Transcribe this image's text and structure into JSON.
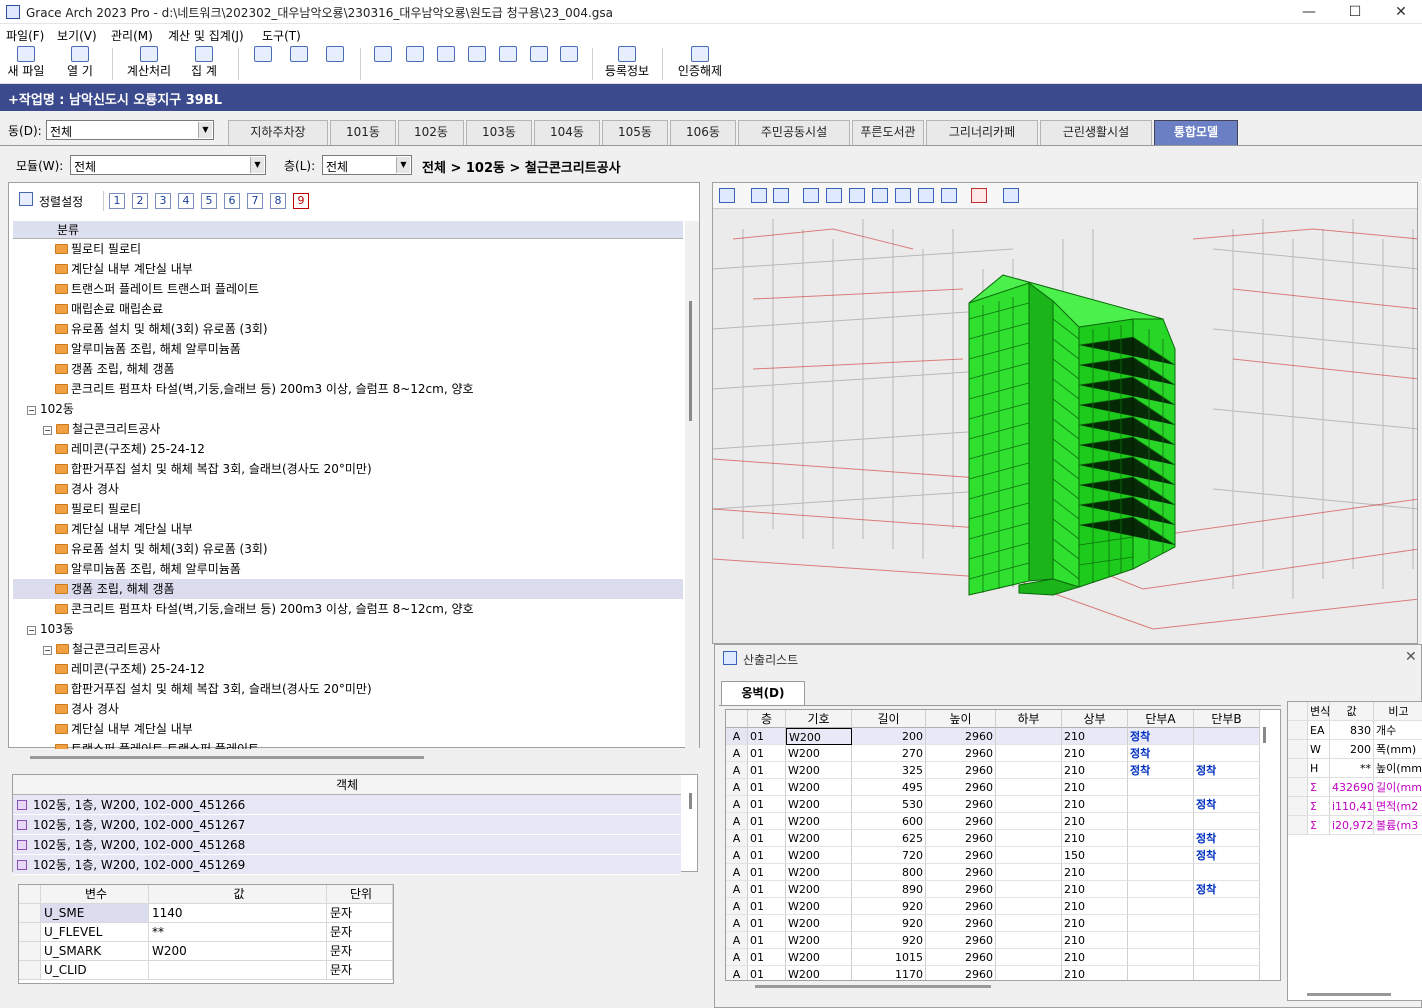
{
  "window": {
    "title": "Grace Arch 2023 Pro - d:\\네트워크\\202302_대우남악오룡\\230316_대우남악오룡\\원도급 청구용\\23_004.gsa",
    "minimize": "—",
    "maximize": "☐",
    "close": "✕"
  },
  "menu": [
    "파일(F)",
    "보기(V)",
    "관리(M)",
    "계산 및 집계(J)",
    "도구(T)"
  ],
  "toolbar": {
    "new": "새 파일",
    "open": "열 기",
    "calc": "계산처리",
    "sum": "집 계",
    "reg": "등록정보",
    "auth": "인증해제"
  },
  "job": "+작업명 : 남악신도시 오룡지구 39BL",
  "dong": {
    "label": "동(D):",
    "value": "전체"
  },
  "tabs": [
    "지하주차장",
    "101동",
    "102동",
    "103동",
    "104동",
    "105동",
    "106동",
    "주민공동시설",
    "푸른도서관",
    "그리너리카페",
    "근린생활시설",
    "통합모델"
  ],
  "module": {
    "label": "모듈(W):",
    "value": "전체"
  },
  "floor": {
    "label": "층(L):",
    "value": "전체"
  },
  "breadcrumb": "전체 > 102동 > 철근콘크리트공사",
  "sort": {
    "label": "정렬설정",
    "nums": [
      "1",
      "2",
      "3",
      "4",
      "5",
      "6",
      "7",
      "8",
      "9"
    ]
  },
  "tree": {
    "header": "분류",
    "rows": [
      {
        "level": 3,
        "text": "필로티  필로티"
      },
      {
        "level": 3,
        "text": "계단실 내부  계단실 내부"
      },
      {
        "level": 3,
        "text": "트랜스퍼 플레이트  트랜스퍼 플레이트"
      },
      {
        "level": 3,
        "text": "매립손료  매립손료"
      },
      {
        "level": 3,
        "text": "유로폼 설치 및 해체(3회)  유로폼 (3회)"
      },
      {
        "level": 3,
        "text": "알루미늄폼 조립, 해체  알루미늄폼"
      },
      {
        "level": 3,
        "text": "갱폼 조립, 해체  갱폼"
      },
      {
        "level": 3,
        "text": "콘크리트 펌프차 타설(벽,기둥,슬래브 등)  200m3 이상, 슬럼프 8~12cm, 양호"
      },
      {
        "level": 1,
        "text": "102동",
        "pm": "−"
      },
      {
        "level": 2,
        "text": "철근콘크리트공사",
        "pm": "−"
      },
      {
        "level": 3,
        "text": "레미콘(구조체)  25-24-12"
      },
      {
        "level": 3,
        "text": "합판거푸집 설치 및 해체  복잡 3회, 슬래브(경사도 20°미만)"
      },
      {
        "level": 3,
        "text": "경사  경사"
      },
      {
        "level": 3,
        "text": "필로티  필로티"
      },
      {
        "level": 3,
        "text": "계단실 내부  계단실 내부"
      },
      {
        "level": 3,
        "text": "유로폼 설치 및 해체(3회)  유로폼 (3회)"
      },
      {
        "level": 3,
        "text": "알루미늄폼 조립, 해체  알루미늄폼"
      },
      {
        "level": 3,
        "text": "갱폼 조립, 해체  갱폼",
        "selected": true
      },
      {
        "level": 3,
        "text": "콘크리트 펌프차 타설(벽,기둥,슬래브 등)  200m3 이상, 슬럼프 8~12cm, 양호"
      },
      {
        "level": 1,
        "text": "103동",
        "pm": "−"
      },
      {
        "level": 2,
        "text": "철근콘크리트공사",
        "pm": "−"
      },
      {
        "level": 3,
        "text": "레미콘(구조체)  25-24-12"
      },
      {
        "level": 3,
        "text": "합판거푸집 설치 및 해체  복잡 3회, 슬래브(경사도 20°미만)"
      },
      {
        "level": 3,
        "text": "경사  경사"
      },
      {
        "level": 3,
        "text": "계단실 내부  계단실 내부"
      },
      {
        "level": 3,
        "text": "트랜스퍼 플레이트  트랜스퍼 플레이트"
      }
    ]
  },
  "objects": {
    "header": "객체",
    "rows": [
      "102동, 1층, W200, 102-000_451266",
      "102동, 1층, W200, 102-000_451267",
      "102동, 1층, W200, 102-000_451268",
      "102동, 1층, W200, 102-000_451269"
    ]
  },
  "vars": {
    "headers": [
      "변수",
      "값",
      "단위"
    ],
    "rows": [
      [
        "U_SME",
        "1140",
        "문자"
      ],
      [
        "U_FLEVEL",
        "**",
        "문자"
      ],
      [
        "U_SMARK",
        "W200",
        "문자"
      ],
      [
        "U_CLID",
        "",
        "문자"
      ]
    ]
  },
  "calc": {
    "title": "산출리스트",
    "close": "✕",
    "tab": "옹벽(D)",
    "headers": [
      "",
      "층",
      "기호",
      "길이",
      "높이",
      "하부",
      "상부",
      "단부A",
      "단부B"
    ],
    "rows": [
      [
        "A",
        "01",
        "W200",
        "200",
        "2960",
        "",
        "210",
        "정착",
        ""
      ],
      [
        "A",
        "01",
        "W200",
        "270",
        "2960",
        "",
        "210",
        "정착",
        ""
      ],
      [
        "A",
        "01",
        "W200",
        "325",
        "2960",
        "",
        "210",
        "정착",
        "정착"
      ],
      [
        "A",
        "01",
        "W200",
        "495",
        "2960",
        "",
        "210",
        "",
        ""
      ],
      [
        "A",
        "01",
        "W200",
        "530",
        "2960",
        "",
        "210",
        "",
        "정착"
      ],
      [
        "A",
        "01",
        "W200",
        "600",
        "2960",
        "",
        "210",
        "",
        ""
      ],
      [
        "A",
        "01",
        "W200",
        "625",
        "2960",
        "",
        "210",
        "",
        "정착"
      ],
      [
        "A",
        "01",
        "W200",
        "720",
        "2960",
        "",
        "150",
        "",
        "정착"
      ],
      [
        "A",
        "01",
        "W200",
        "800",
        "2960",
        "",
        "210",
        "",
        ""
      ],
      [
        "A",
        "01",
        "W200",
        "890",
        "2960",
        "",
        "210",
        "",
        "정착"
      ],
      [
        "A",
        "01",
        "W200",
        "920",
        "2960",
        "",
        "210",
        "",
        ""
      ],
      [
        "A",
        "01",
        "W200",
        "920",
        "2960",
        "",
        "210",
        "",
        ""
      ],
      [
        "A",
        "01",
        "W200",
        "920",
        "2960",
        "",
        "210",
        "",
        ""
      ],
      [
        "A",
        "01",
        "W200",
        "1015",
        "2960",
        "",
        "210",
        "",
        ""
      ],
      [
        "A",
        "01",
        "W200",
        "1170",
        "2960",
        "",
        "210",
        "",
        ""
      ]
    ]
  },
  "summary": {
    "headers": [
      "변식",
      "값",
      "비고"
    ],
    "rows": [
      {
        "k": "EA",
        "v": "830",
        "n": "개수",
        "sigma": false
      },
      {
        "k": "W",
        "v": "200",
        "n": "폭(mm)",
        "sigma": false
      },
      {
        "k": "H",
        "v": "**",
        "n": "높이(mm",
        "sigma": false
      },
      {
        "k": "Σ",
        "v": "432690",
        "n": "길이(mm",
        "sigma": true
      },
      {
        "k": "Σ",
        "v": "i110,41",
        "n": "면적(m2",
        "sigma": true
      },
      {
        "k": "Σ",
        "v": "i20,972",
        "n": "볼륨(m3",
        "sigma": true
      }
    ]
  },
  "colors": {
    "accent": "#3a4a8c",
    "activeTab": "#6b7fc4",
    "model": "#22dd22",
    "sigma": "#c000c0",
    "anchor": "#0030c0"
  }
}
